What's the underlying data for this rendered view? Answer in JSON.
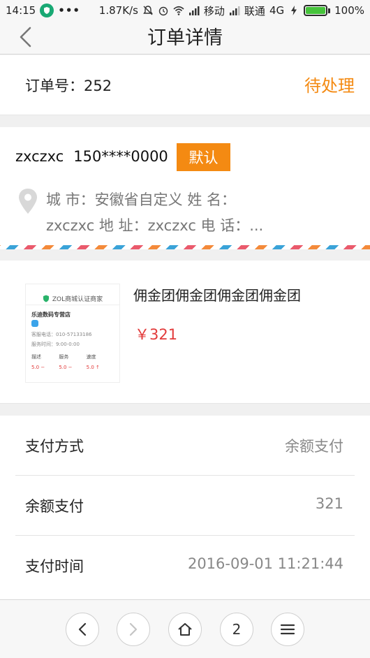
{
  "status_bar": {
    "time": "14:15",
    "dots": "•••",
    "speed": "1.87K/s",
    "carrier1": "移动",
    "carrier2": "联通",
    "network": "4G",
    "battery": "100%",
    "battery_level": 1.0
  },
  "header": {
    "title": "订单详情",
    "back_icon": "chevron-left-icon"
  },
  "order": {
    "number_label": "订单号：252",
    "status": "待处理"
  },
  "address": {
    "name": "zxczxc",
    "phone": "150****0000",
    "default_badge": "默认",
    "line1": "城 市：安徽省自定义 姓 名：",
    "line2": "zxczxc 地 址：zxczxc 电 话：..."
  },
  "product": {
    "title": "佣金团佣金团佣金团佣金团",
    "price": "￥321",
    "thumb": {
      "brand": "ZOL商城认证商家",
      "store": "乐迪数码专营店",
      "phone": "客服电话：010-57133186",
      "hours": "服务时间：9:00-0:00",
      "scores": [
        {
          "label": "描述",
          "value": "5.0 −"
        },
        {
          "label": "服务",
          "value": "5.0 −"
        },
        {
          "label": "速度",
          "value": "5.0 ↑"
        }
      ]
    }
  },
  "payment": {
    "rows": [
      {
        "label": "支付方式",
        "value": "余额支付"
      },
      {
        "label": "余额支付",
        "value": "321"
      },
      {
        "label": "支付时间",
        "value": "2016-09-01 11:21:44"
      }
    ]
  },
  "bottom_nav": {
    "tabs_count": "2",
    "icons": [
      "back-arrow-icon",
      "forward-arrow-icon",
      "home-icon",
      "tabs-count",
      "menu-icon"
    ]
  }
}
